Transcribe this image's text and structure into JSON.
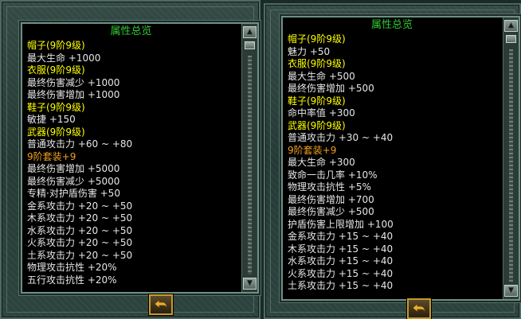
{
  "left_panel": {
    "title": "属性总览",
    "rows": [
      {
        "text": "帽子(9阶9级)",
        "color": "yellow"
      },
      {
        "text": "最大生命 +1000",
        "color": "white"
      },
      {
        "text": "衣服(9阶9级)",
        "color": "yellow"
      },
      {
        "text": "最终伤害减少 +1000",
        "color": "white"
      },
      {
        "text": "最终伤害增加 +1000",
        "color": "white"
      },
      {
        "text": "鞋子(9阶9级)",
        "color": "yellow"
      },
      {
        "text": "敏捷 +150",
        "color": "white"
      },
      {
        "text": "武器(9阶9级)",
        "color": "yellow"
      },
      {
        "text": "普通攻击力 +60 ~ +80",
        "color": "white"
      },
      {
        "text": "9阶套装+9",
        "color": "gold"
      },
      {
        "text": "最终伤害增加 +5000",
        "color": "white"
      },
      {
        "text": "最终伤害减少 +5000",
        "color": "white"
      },
      {
        "text": "专精·对护盾伤害 +50",
        "color": "white"
      },
      {
        "text": "金系攻击力 +20 ~ +50",
        "color": "white"
      },
      {
        "text": "木系攻击力 +20 ~ +50",
        "color": "white"
      },
      {
        "text": "水系攻击力 +20 ~ +50",
        "color": "white"
      },
      {
        "text": "火系攻击力 +20 ~ +50",
        "color": "white"
      },
      {
        "text": "土系攻击力 +20 ~ +50",
        "color": "white"
      },
      {
        "text": "物理攻击抗性 +20%",
        "color": "white"
      },
      {
        "text": "五行攻击抗性 +20%",
        "color": "white"
      }
    ]
  },
  "right_panel": {
    "title": "属性总览",
    "rows": [
      {
        "text": "帽子(9阶9级)",
        "color": "yellow"
      },
      {
        "text": "魅力 +50",
        "color": "white"
      },
      {
        "text": "衣服(9阶9级)",
        "color": "yellow"
      },
      {
        "text": "最大生命 +500",
        "color": "white"
      },
      {
        "text": "最终伤害增加 +500",
        "color": "white"
      },
      {
        "text": "鞋子(9阶9级)",
        "color": "yellow"
      },
      {
        "text": "命中率值 +300",
        "color": "white"
      },
      {
        "text": "武器(9阶9级)",
        "color": "yellow"
      },
      {
        "text": "普通攻击力 +30 ~ +40",
        "color": "white"
      },
      {
        "text": "9阶套装+9",
        "color": "gold"
      },
      {
        "text": "最大生命 +300",
        "color": "white"
      },
      {
        "text": "致命一击几率 +10%",
        "color": "white"
      },
      {
        "text": "物理攻击抗性 +5%",
        "color": "white"
      },
      {
        "text": "最终伤害增加 +700",
        "color": "white"
      },
      {
        "text": "最终伤害减少 +500",
        "color": "white"
      },
      {
        "text": "护盾伤害上限增加 +100",
        "color": "white"
      },
      {
        "text": "金系攻击力 +15 ~ +40",
        "color": "white"
      },
      {
        "text": "木系攻击力 +15 ~ +40",
        "color": "white"
      },
      {
        "text": "水系攻击力 +15 ~ +40",
        "color": "white"
      },
      {
        "text": "火系攻击力 +15 ~ +40",
        "color": "white"
      },
      {
        "text": "土系攻击力 +15 ~ +40",
        "color": "white"
      }
    ]
  },
  "icons": {
    "scroll_up": "scroll-up-arrow-icon",
    "scroll_down": "scroll-down-arrow-icon",
    "back": "back-arrow-icon"
  },
  "colors": {
    "yellow": "#ffff00",
    "green": "#32dc32",
    "gold": "#f0a020",
    "white": "#e6e6e6"
  }
}
